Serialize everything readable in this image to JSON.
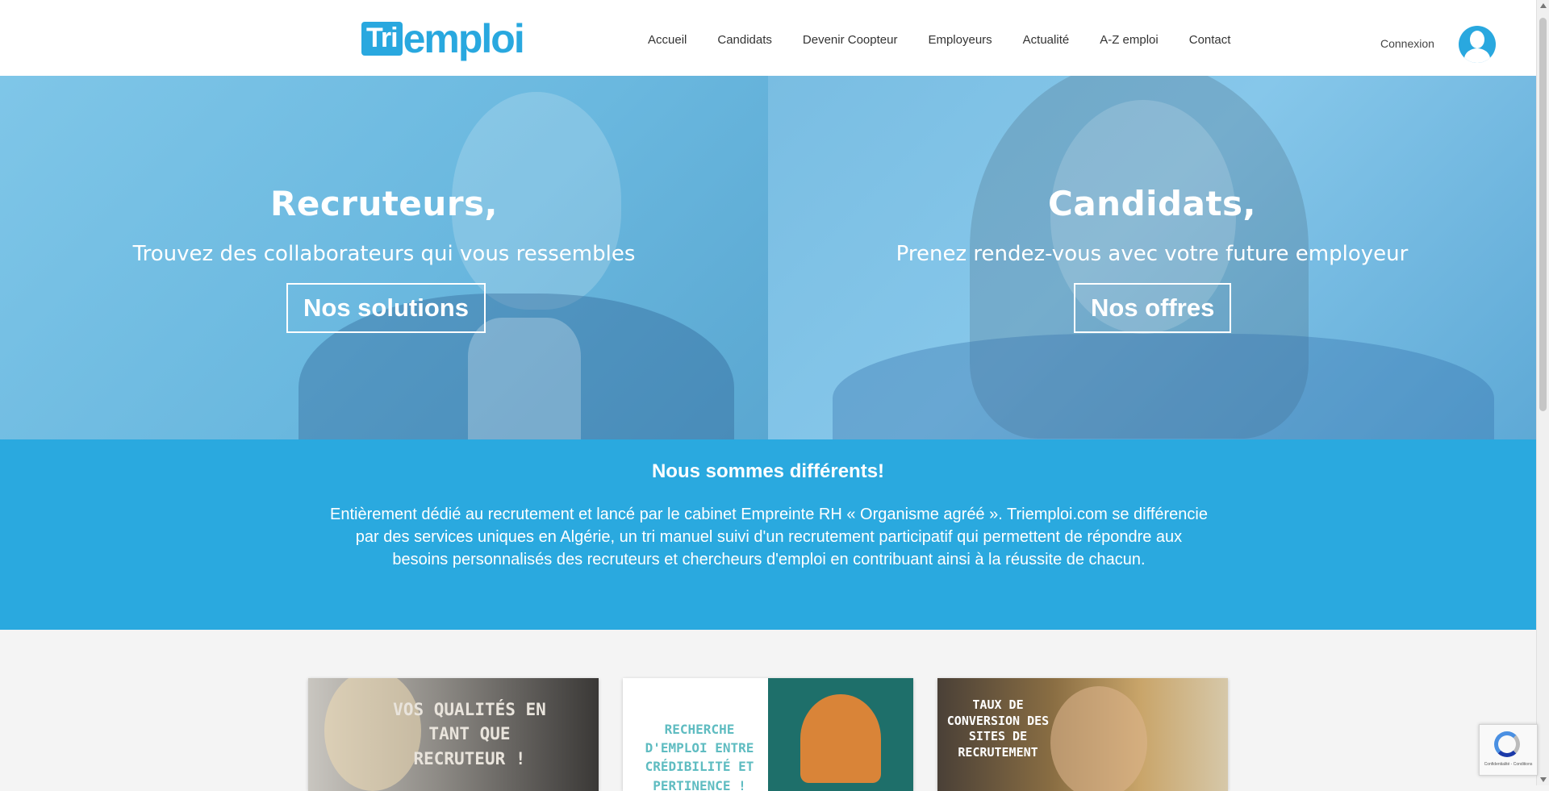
{
  "header": {
    "logo_prefix": "Tri",
    "logo_word": "emploi",
    "nav": [
      "Accueil",
      "Candidats",
      "Devenir Coopteur",
      "Employeurs",
      "Actualité",
      "A-Z emploi",
      "Contact"
    ],
    "login": "Connexion",
    "avatar_icon": "user-avatar-icon"
  },
  "hero": {
    "left": {
      "title": "Recruteurs,",
      "subtitle": "Trouvez des collaborateurs qui vous ressembles",
      "button": "Nos solutions"
    },
    "right": {
      "title": "Candidats,",
      "subtitle": "Prenez rendez-vous avec votre future employeur",
      "button": "Nos offres"
    }
  },
  "about": {
    "title": "Nous sommes différents!",
    "text": "Entièrement dédié au recrutement et lancé par le cabinet Empreinte RH « Organisme agréé ». Triemploi.com se différencie par des services uniques en Algérie, un tri manuel suivi d'un recrutement participatif qui permettent de répondre aux besoins personnalisés des recruteurs et chercheurs d'emploi en contribuant ainsi à la réussite de chacun."
  },
  "cards": [
    {
      "text": "Vos qualités en tant que recruteur !"
    },
    {
      "text": "Recherche d'emploi entre crédibilité et pertinence !"
    },
    {
      "text": "Taux de conversion des sites de recrutement"
    }
  ],
  "recaptcha": {
    "text": "Confidentialité - Conditions"
  },
  "colors": {
    "brand": "#29a8df",
    "band": "#2aa9df"
  }
}
